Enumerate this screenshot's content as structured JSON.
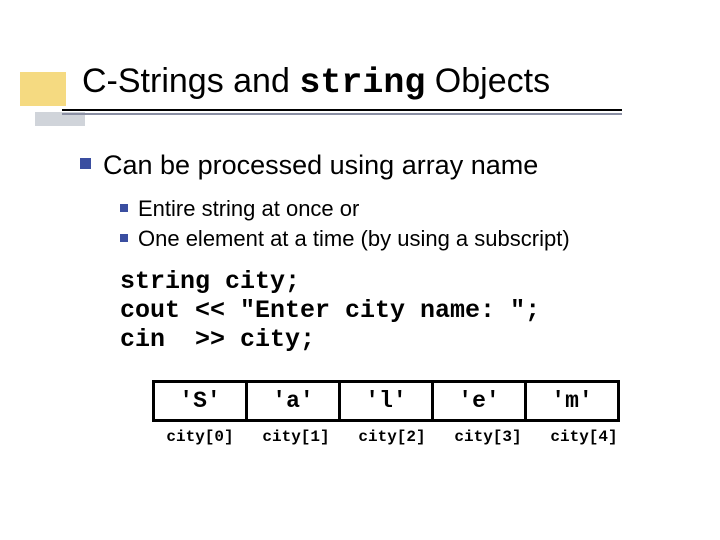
{
  "title": {
    "pre": "C-Strings and ",
    "code": "string",
    "post": " Objects"
  },
  "bullets": {
    "top": "Can be processed using array name",
    "sub1": "Entire string at once or",
    "sub2": "One element at a time (by using a subscript)"
  },
  "code": "string city;\ncout << \"Enter city name: \";\ncin  >> city;",
  "table": {
    "cells": [
      "'S'",
      "'a'",
      "'l'",
      "'e'",
      "'m'"
    ],
    "labels": [
      "city[0]",
      "city[1]",
      "city[2]",
      "city[3]",
      "city[4]"
    ]
  }
}
